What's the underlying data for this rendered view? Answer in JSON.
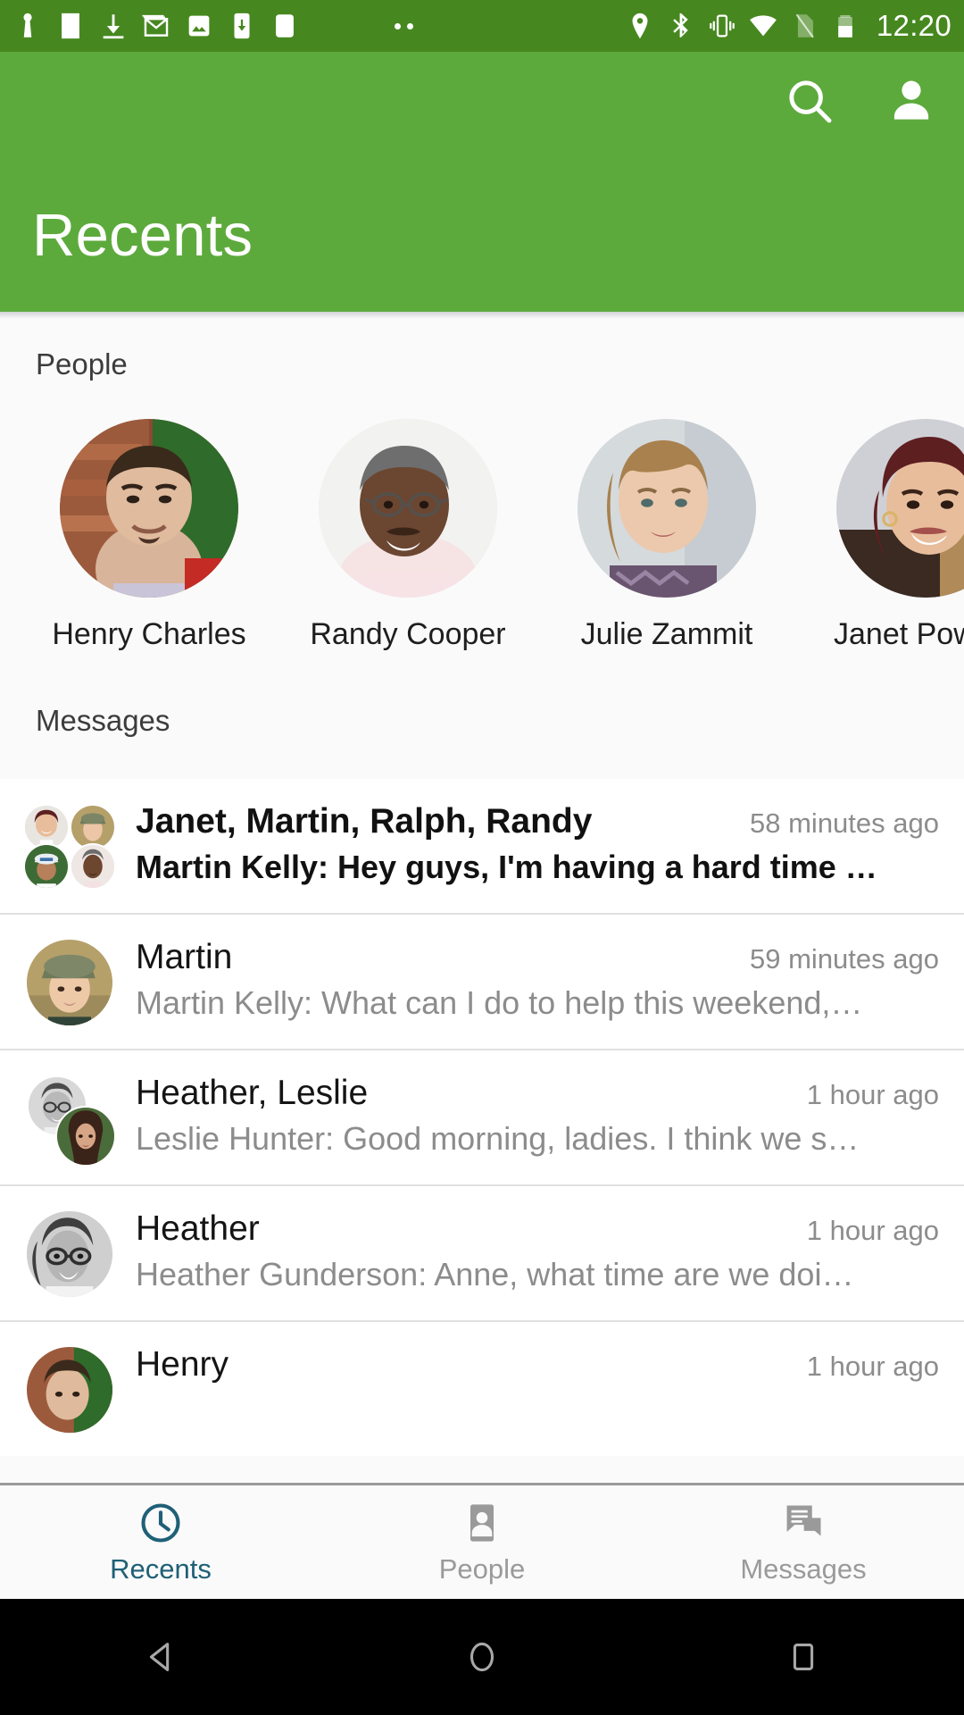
{
  "statusbar": {
    "time": "12:20",
    "left_icons": [
      "keyguard-icon",
      "facebook-icon",
      "download-icon",
      "gmail-icon",
      "photos-icon",
      "app-download-icon",
      "blank-notification-icon"
    ],
    "right_icons": [
      "location-icon",
      "bluetooth-icon",
      "vibrate-icon",
      "wifi-icon",
      "no-sim-icon",
      "battery-icon"
    ],
    "background": "#46881f"
  },
  "appbar": {
    "title": "Recents",
    "background": "#5daa3c",
    "search_label": "search-icon",
    "account_label": "account-icon"
  },
  "sections": {
    "people_label": "People",
    "messages_label": "Messages"
  },
  "people": [
    {
      "name": "Henry Charles",
      "avatar": "man-brick-wall"
    },
    {
      "name": "Randy Cooper",
      "avatar": "man-glasses-mustache"
    },
    {
      "name": "Julie Zammit",
      "avatar": "woman-scarf"
    },
    {
      "name": "Janet Powers",
      "avatar": "woman-dark-red-hair"
    }
  ],
  "messages": [
    {
      "title": "Janet, Martin, Ralph, Randy",
      "snippet": "Martin Kelly: Hey guys, I'm having a hard time …",
      "time": "58 minutes ago",
      "unread": true,
      "avatar_type": "group4"
    },
    {
      "title": "Martin",
      "snippet": "Martin Kelly: What can I do to help this weekend,…",
      "time": "59 minutes ago",
      "unread": false,
      "avatar_type": "single-man-cap"
    },
    {
      "title": "Heather, Leslie",
      "snippet": "Leslie Hunter: Good morning, ladies. I think we s…",
      "time": "1 hour ago",
      "unread": false,
      "avatar_type": "group2"
    },
    {
      "title": "Heather",
      "snippet": "Heather Gunderson: Anne, what time are we doi…",
      "time": "1 hour ago",
      "unread": false,
      "avatar_type": "single-woman-glasses"
    },
    {
      "title": "Henry",
      "snippet": "",
      "time": "1 hour ago",
      "unread": false,
      "avatar_type": "single-man-brick"
    }
  ],
  "tabs": [
    {
      "label": "Recents",
      "icon": "clock-icon",
      "active": true
    },
    {
      "label": "People",
      "icon": "contact-card-icon",
      "active": false
    },
    {
      "label": "Messages",
      "icon": "chat-bubbles-icon",
      "active": false
    }
  ],
  "colors": {
    "accent_green": "#5daa3c",
    "statusbar_green": "#46881f",
    "active_tab": "#1f6077",
    "inactive_tab": "#9a9a9a"
  },
  "navbar": {
    "back": "back-triangle-icon",
    "home": "home-circle-icon",
    "recents": "recents-square-icon"
  }
}
